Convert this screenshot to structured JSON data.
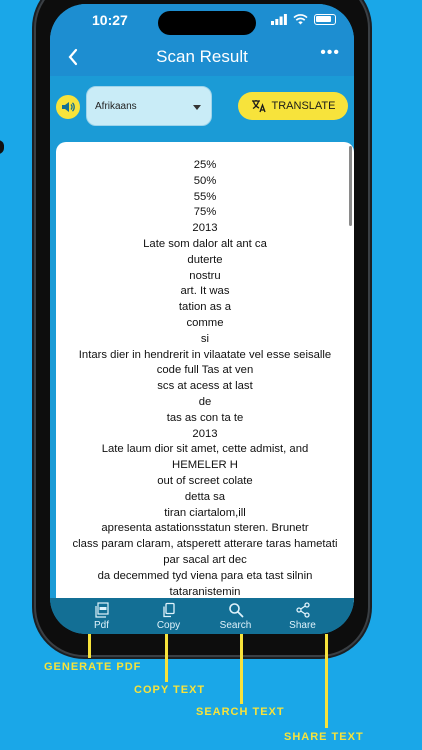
{
  "status_bar": {
    "time": "10:27"
  },
  "header": {
    "title": "Scan Result",
    "more": "•••"
  },
  "toolbar": {
    "language": "Afrikaans",
    "translate_label": "TRANSLATE"
  },
  "result_text": "25%\n50%\n55%\n75%\n2013\nLate som dalor alt ant ca\nduterte\nnostru\nart. It was\ntation as a\ncomme\nsi\nIntars dier in hendrerit in vilaatate vel esse seisalle\ncode full Tas at ven\nscs at acess at last\nde\ntas as con ta te\n2013\nLate laum dior sit amet, cette admist, and\nHEMELER H\nout of screet colate\ndetta sa\ntiran ciartalom,ill\napresenta astationsstatun steren. Brunetr\nclass param claram, atsperett atterare taras hametati\npar sacal art dec\nda decemmed tyd viena para eta tast silnin\ntataranistemin\nmatch dan the time it tartalm\nvistas twa, ust talles lamcorper il bertis nisl ut aliq\nat. Tuls autam val som re der beste inatate villa ole\ntacitit\net annet tasto di\ndiam\nfalar to reaga le ultal, am her lamper eum sta noble",
  "bottom_bar": {
    "pdf": "Pdf",
    "copy": "Copy",
    "search": "Search",
    "share": "Share"
  },
  "callouts": {
    "generate_pdf": "GENERATE PDF",
    "copy_text": "COPY TEXT",
    "search_text": "SEARCH TEXT",
    "share_text": "SHARE TEXT"
  },
  "colors": {
    "background": "#1aa7e8",
    "app_bar": "#1d8ed1",
    "accent_yellow": "#f7e33b",
    "bottom_bar": "#136f95"
  }
}
